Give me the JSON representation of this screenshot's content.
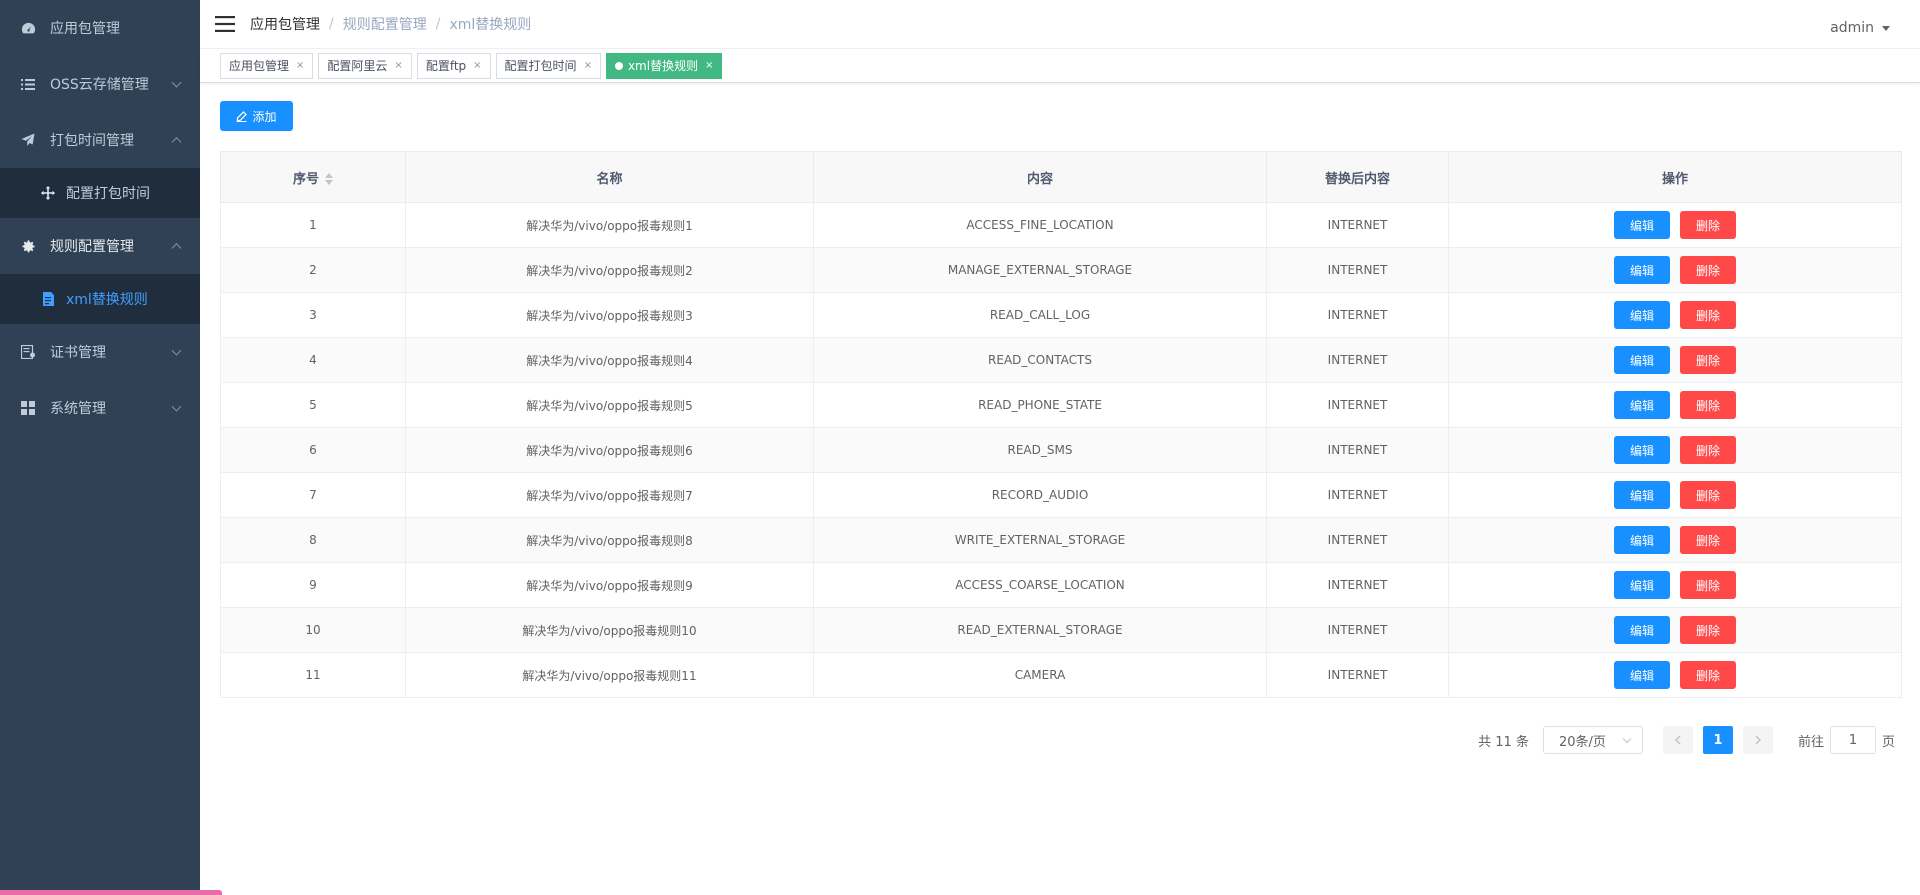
{
  "sidebar": {
    "items": [
      {
        "label": "应用包管理",
        "icon": "dashboard-icon"
      },
      {
        "label": "OSS云存储管理",
        "icon": "list-icon"
      },
      {
        "label": "打包时间管理",
        "icon": "send-icon"
      },
      {
        "label": "配置打包时间",
        "icon": "move-icon"
      },
      {
        "label": "规则配置管理",
        "icon": "gear-icon"
      },
      {
        "label": "xml替换规则",
        "icon": "document-icon"
      },
      {
        "label": "证书管理",
        "icon": "certificate-icon"
      },
      {
        "label": "系统管理",
        "icon": "grid-icon"
      }
    ]
  },
  "navbar": {
    "breadcrumb": [
      "应用包管理",
      "规则配置管理",
      "xml替换规则"
    ],
    "separator": "/",
    "user": "admin"
  },
  "tags": [
    {
      "label": "应用包管理",
      "close": "×"
    },
    {
      "label": "配置阿里云",
      "close": "×"
    },
    {
      "label": "配置ftp",
      "close": "×"
    },
    {
      "label": "配置打包时间",
      "close": "×"
    },
    {
      "label": "xml替换规则",
      "close": "×",
      "active": true
    }
  ],
  "toolbar": {
    "add_label": "添加"
  },
  "table": {
    "headers": [
      "序号",
      "名称",
      "内容",
      "替换后内容",
      "操作"
    ],
    "edit_label": "编辑",
    "delete_label": "删除",
    "rows": [
      {
        "id": "1",
        "name": "解决华为/vivo/oppo报毒规则1",
        "content": "ACCESS_FINE_LOCATION",
        "replacement": "INTERNET"
      },
      {
        "id": "2",
        "name": "解决华为/vivo/oppo报毒规则2",
        "content": "MANAGE_EXTERNAL_STORAGE",
        "replacement": "INTERNET"
      },
      {
        "id": "3",
        "name": "解决华为/vivo/oppo报毒规则3",
        "content": "READ_CALL_LOG",
        "replacement": "INTERNET"
      },
      {
        "id": "4",
        "name": "解决华为/vivo/oppo报毒规则4",
        "content": "READ_CONTACTS",
        "replacement": "INTERNET"
      },
      {
        "id": "5",
        "name": "解决华为/vivo/oppo报毒规则5",
        "content": "READ_PHONE_STATE",
        "replacement": "INTERNET"
      },
      {
        "id": "6",
        "name": "解决华为/vivo/oppo报毒规则6",
        "content": "READ_SMS",
        "replacement": "INTERNET"
      },
      {
        "id": "7",
        "name": "解决华为/vivo/oppo报毒规则7",
        "content": "RECORD_AUDIO",
        "replacement": "INTERNET"
      },
      {
        "id": "8",
        "name": "解决华为/vivo/oppo报毒规则8",
        "content": "WRITE_EXTERNAL_STORAGE",
        "replacement": "INTERNET"
      },
      {
        "id": "9",
        "name": "解决华为/vivo/oppo报毒规则9",
        "content": "ACCESS_COARSE_LOCATION",
        "replacement": "INTERNET"
      },
      {
        "id": "10",
        "name": "解决华为/vivo/oppo报毒规则10",
        "content": "READ_EXTERNAL_STORAGE",
        "replacement": "INTERNET"
      },
      {
        "id": "11",
        "name": "解决华为/vivo/oppo报毒规则11",
        "content": "CAMERA",
        "replacement": "INTERNET"
      }
    ]
  },
  "pagination": {
    "total_text": "共 11 条",
    "page_size": "20条/页",
    "current_page": "1",
    "goto_prefix": "前往",
    "goto_value": "1",
    "goto_suffix": "页"
  },
  "colors": {
    "sidebar_bg": "#304156",
    "submenu_bg": "#1f2d3d",
    "primary": "#1890ff",
    "danger": "#ff4949",
    "active_tag": "#42b983",
    "active_menu_text": "#409eff"
  }
}
